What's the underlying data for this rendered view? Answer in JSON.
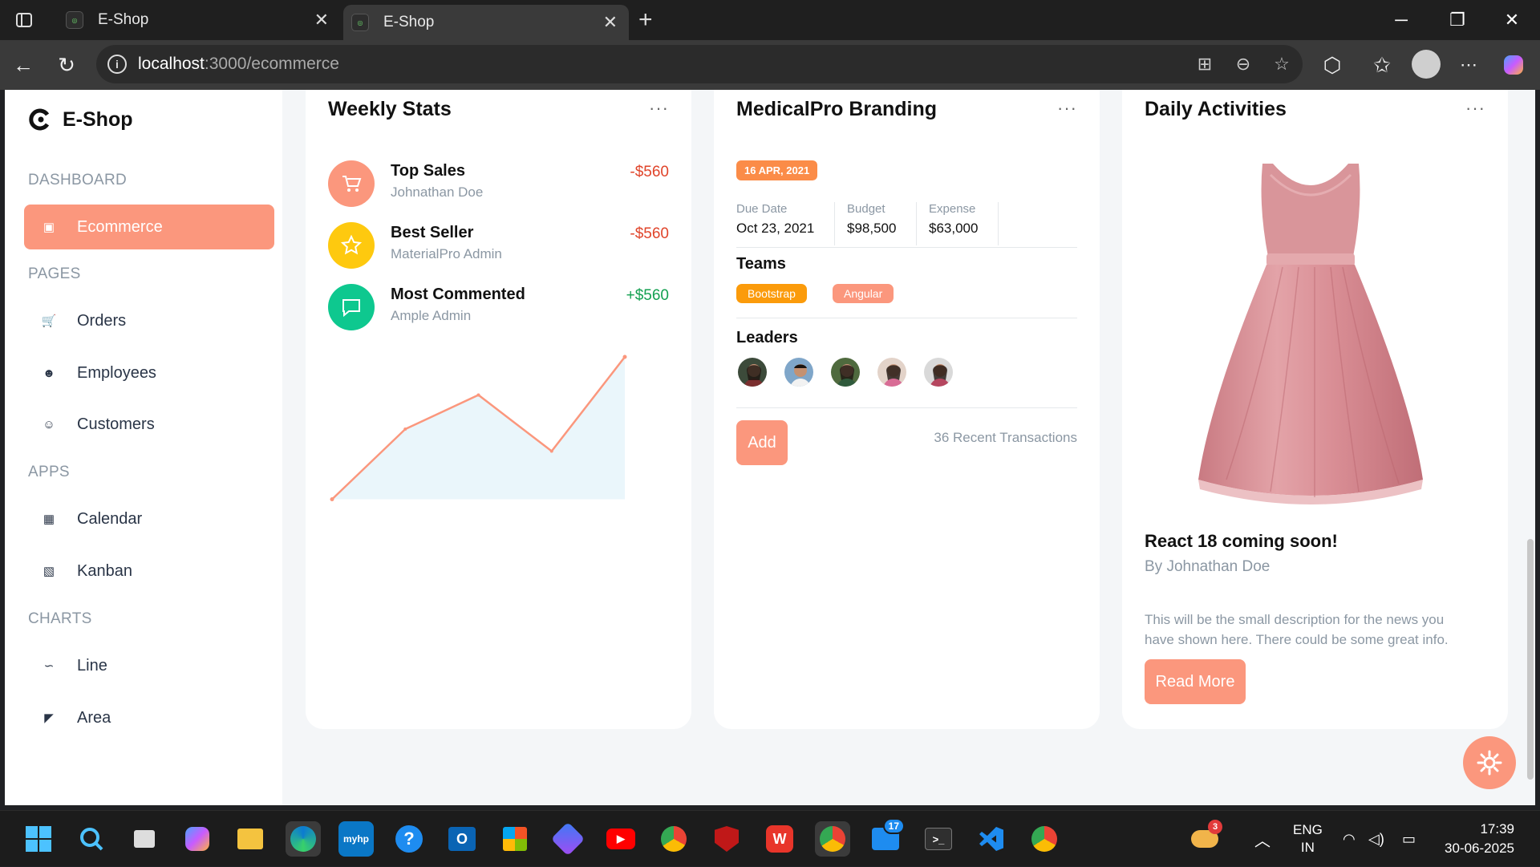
{
  "browser": {
    "tabs": [
      {
        "title": "E-Shop",
        "favicon_text": "E-SHOP",
        "active": false
      },
      {
        "title": "E-Shop",
        "favicon_text": "E-SHOP",
        "active": true
      }
    ],
    "url_host": "localhost",
    "url_path": ":3000/ecommerce"
  },
  "sidebar": {
    "brand": "E-Shop",
    "sections": [
      {
        "title": "DASHBOARD",
        "items": [
          {
            "label": "Ecommerce",
            "icon": "bag-icon",
            "active": true
          }
        ]
      },
      {
        "title": "PAGES",
        "items": [
          {
            "label": "Orders",
            "icon": "cart-icon"
          },
          {
            "label": "Employees",
            "icon": "users-icon"
          },
          {
            "label": "Customers",
            "icon": "user-list-icon"
          }
        ]
      },
      {
        "title": "APPS",
        "items": [
          {
            "label": "Calendar",
            "icon": "calendar-icon"
          },
          {
            "label": "Kanban",
            "icon": "kanban-icon"
          }
        ]
      },
      {
        "title": "CHARTS",
        "items": [
          {
            "label": "Line",
            "icon": "line-chart-icon"
          },
          {
            "label": "Area",
            "icon": "area-chart-icon"
          }
        ]
      }
    ]
  },
  "weekly_stats": {
    "title": "Weekly Stats",
    "menu": "···",
    "items": [
      {
        "title": "Top Sales",
        "subtitle": "Johnathan Doe",
        "value": "-$560",
        "color": "#fb977d",
        "icon": "cart-icon"
      },
      {
        "title": "Best Seller",
        "subtitle": "MaterialPro Admin",
        "value": "-$560",
        "color": "#fec90f",
        "icon": "star-icon"
      },
      {
        "title": "Most Commented",
        "subtitle": "Ample Admin",
        "value": "+$560",
        "color": "#0ec88f",
        "icon": "chat-icon"
      }
    ],
    "chart_data": {
      "type": "area",
      "x": [
        1,
        2,
        3,
        4,
        5
      ],
      "values": [
        5,
        40,
        57,
        29,
        76
      ],
      "ylim": [
        0,
        80
      ],
      "grid": false,
      "line_color": "#fb977d",
      "fill_color": "#eaf6fb"
    }
  },
  "branding": {
    "title": "MedicalPro Branding",
    "menu": "···",
    "date_badge": "16 APR, 2021",
    "fields": [
      {
        "label": "Due Date",
        "value": "Oct 23, 2021"
      },
      {
        "label": "Budget",
        "value": "$98,500"
      },
      {
        "label": "Expense",
        "value": "$63,000"
      }
    ],
    "teams_title": "Teams",
    "teams": [
      {
        "label": "Bootstrap",
        "color": "#fb9b0b"
      },
      {
        "label": "Angular",
        "color": "#fb977d"
      }
    ],
    "leaders_title": "Leaders",
    "leaders_count": 5,
    "add_label": "Add",
    "recent": "36 Recent Transactions"
  },
  "daily": {
    "title": "Daily Activities",
    "menu": "···",
    "news_title": "React 18 coming soon!",
    "news_by": "By Johnathan Doe",
    "news_desc": "This will be the small description for the news you have shown here. There could be some great info.",
    "read_more": "Read More"
  },
  "taskbar": {
    "lang1": "ENG",
    "lang2": "IN",
    "time": "17:39",
    "date": "30-06-2025",
    "weather_badge": "3",
    "mail_badge": "17",
    "hp_label": "myhp"
  },
  "colors": {
    "accent": "#fb977d",
    "page_bg": "#f4f6f8"
  }
}
